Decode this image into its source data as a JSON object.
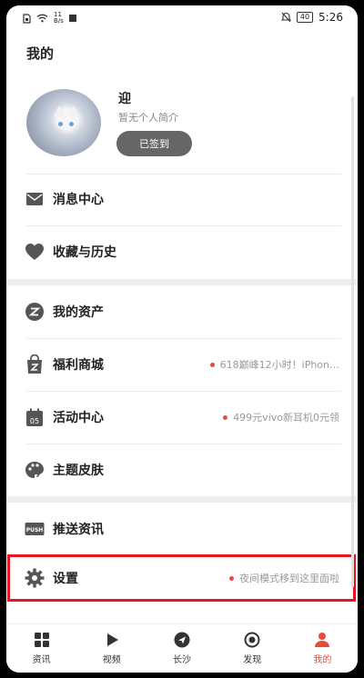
{
  "status_bar": {
    "network_speed_value": "11",
    "network_speed_unit": "B/s",
    "battery": "40",
    "time": "5:26"
  },
  "page_title": "我的",
  "profile": {
    "name": "迎",
    "bio": "暂无个人简介",
    "signin_label": "已签到"
  },
  "section1": [
    {
      "label": "消息中心",
      "icon": "mail-icon"
    },
    {
      "label": "收藏与历史",
      "icon": "heart-icon"
    }
  ],
  "section2": [
    {
      "label": "我的资产",
      "icon": "asset-icon",
      "hint": ""
    },
    {
      "label": "福利商城",
      "icon": "shopping-bag-icon",
      "hint": "618巅峰12小时！iPhon…"
    },
    {
      "label": "活动中心",
      "icon": "calendar-icon",
      "hint": "499元vivo新耳机0元领"
    },
    {
      "label": "主题皮肤",
      "icon": "palette-icon",
      "hint": ""
    }
  ],
  "section3": [
    {
      "label": "推送资讯",
      "icon": "push-icon",
      "badge": "PUSH"
    },
    {
      "label": "设置",
      "icon": "gear-icon",
      "hint": "夜间模式移到这里面啦"
    }
  ],
  "bottom_nav": [
    {
      "label": "资讯",
      "icon": "grid-icon"
    },
    {
      "label": "视频",
      "icon": "play-icon"
    },
    {
      "label": "长沙",
      "icon": "location-arrow-icon"
    },
    {
      "label": "发现",
      "icon": "target-icon"
    },
    {
      "label": "我的",
      "icon": "person-icon",
      "active": true
    }
  ],
  "colors": {
    "accent": "#e64b3c",
    "highlight_border": "#e8141e",
    "icon_gray": "#555555"
  }
}
